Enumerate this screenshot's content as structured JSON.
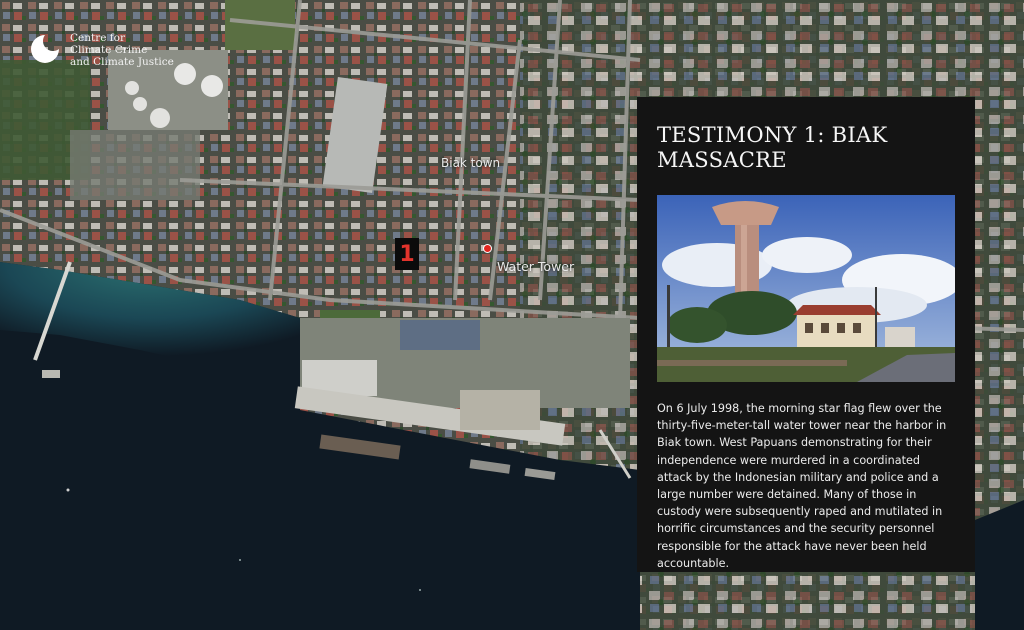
{
  "logo": {
    "line1": "Centre for",
    "line2": "Climate Crime",
    "line3": "and Climate Justice"
  },
  "map": {
    "town_label": "Biak town",
    "pin_label": "Water Tower",
    "marker_number": "1"
  },
  "panel": {
    "title": "TESTIMONY 1: BIAK MASSACRE",
    "body": "On 6 July 1998, the morning star flag flew over the thirty-five-meter-tall water tower near the harbor in Biak town. West Papuans demonstrating for their independence were murdered in a coordinated attack by the Indonesian military and police and a large number were detained. Many of those in custody were subsequently raped and mutilated in horrific circumstances and the security personnel responsible for the attack have never been held accountable."
  },
  "colors": {
    "panel_bg": "#141414",
    "marker_red": "#e3342c",
    "sea": "#0f1a24"
  }
}
